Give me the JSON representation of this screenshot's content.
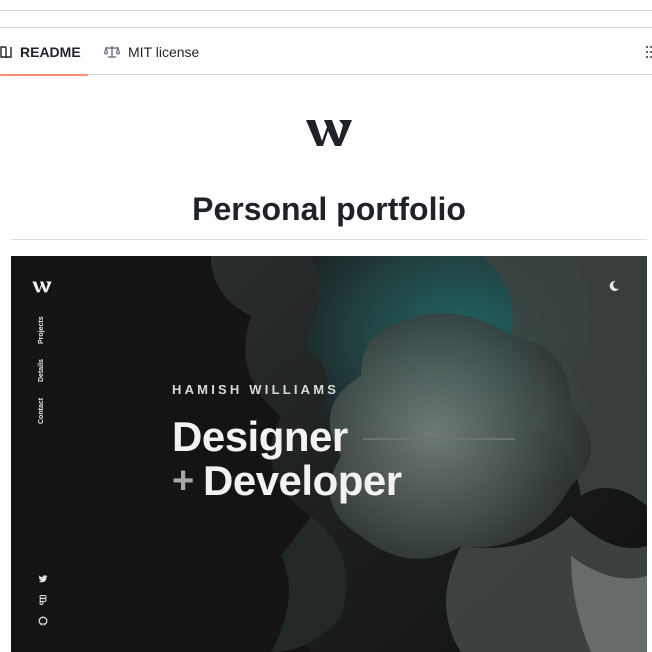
{
  "tabs": {
    "readme": "README",
    "license": "MIT license"
  },
  "readme": {
    "title": "Personal portfolio"
  },
  "hero": {
    "side_nav": [
      "Projects",
      "Details",
      "Contact"
    ],
    "name": "HAMISH WILLIAMS",
    "headline_line1": "Designer",
    "headline_plus": "+",
    "headline_line2": "Developer",
    "theme_icon": "moon-icon",
    "social_icons": [
      "twitter-icon",
      "figma-icon",
      "github-icon"
    ]
  },
  "colors": {
    "tab_underline": "#fd8c73",
    "hero_bg": "#141414",
    "hero_teal": "#1e5f5e",
    "text_primary": "#1f2328"
  }
}
